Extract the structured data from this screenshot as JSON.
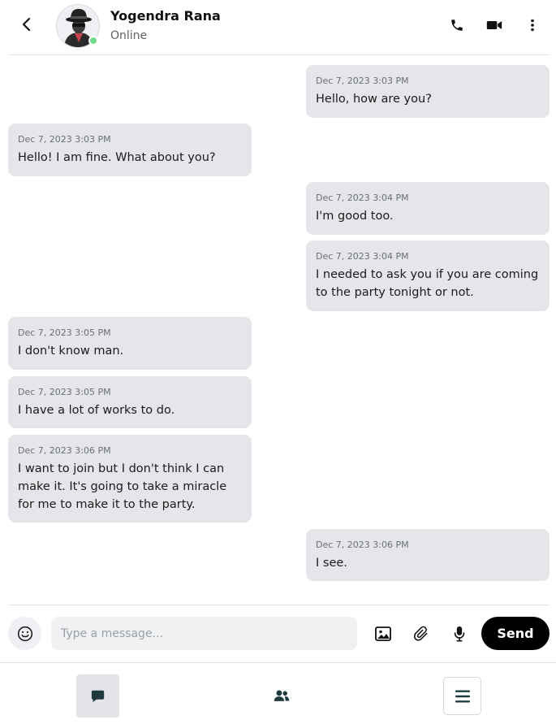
{
  "header": {
    "back_icon": "chevron-left-icon",
    "contact_name": "Yogendra Rana",
    "status": "Online",
    "status_color": "#6fdc8c",
    "icons": [
      "phone-icon",
      "video-icon",
      "more-vertical-icon"
    ]
  },
  "messages": [
    {
      "direction": "sent",
      "time": "Dec 7, 2023 3:03 PM",
      "text": "Hello, how are you?"
    },
    {
      "direction": "received",
      "time": "Dec 7, 2023 3:03 PM",
      "text": "Hello! I am fine. What about you?"
    },
    {
      "direction": "sent",
      "time": "Dec 7, 2023 3:04 PM",
      "text": "I'm good too."
    },
    {
      "direction": "sent",
      "time": "Dec 7, 2023 3:04 PM",
      "text": "I needed to ask you if you are coming to the party tonight or not."
    },
    {
      "direction": "received",
      "time": "Dec 7, 2023 3:05 PM",
      "text": "I don't know man."
    },
    {
      "direction": "received",
      "time": "Dec 7, 2023 3:05 PM",
      "text": "I have a lot of works to do."
    },
    {
      "direction": "received",
      "time": "Dec 7, 2023 3:06 PM",
      "text": "I want to join but I don't think I can make it. It's going to take a miracle for me to make it to the party."
    },
    {
      "direction": "sent",
      "time": "Dec 7, 2023 3:06 PM",
      "text": "I see."
    }
  ],
  "composer": {
    "emoji_icon": "smiley-icon",
    "placeholder": "Type a message...",
    "value": "",
    "tools": [
      "image-icon",
      "paperclip-icon",
      "microphone-icon"
    ],
    "send_label": "Send"
  },
  "bottom_nav": {
    "items": [
      "chat-icon",
      "users-icon",
      "menu-icon"
    ],
    "active": "chat-icon",
    "icon_color": "#1f3b3d"
  }
}
